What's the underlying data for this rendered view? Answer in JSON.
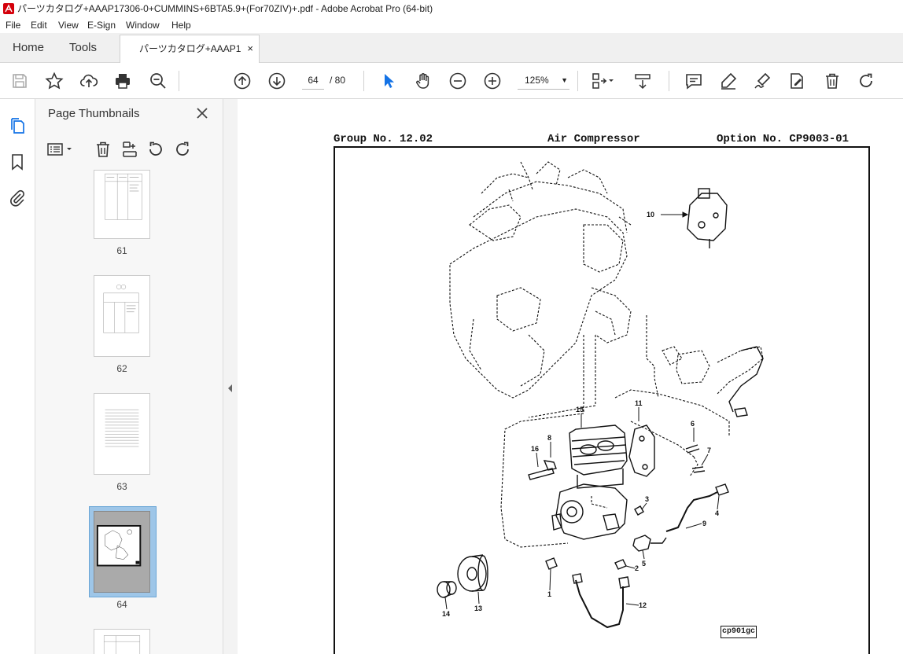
{
  "window": {
    "title": "パーツカタログ+AAAP17306-0+CUMMINS+6BTA5.9+(For70ZIV)+.pdf - Adobe Acrobat Pro (64-bit)"
  },
  "menu": [
    "File",
    "Edit",
    "View",
    "E-Sign",
    "Window",
    "Help"
  ],
  "tabs": {
    "home": "Home",
    "tools": "Tools",
    "document": "パーツカタログ+AAAP1...",
    "close": "×"
  },
  "toolbar": {
    "page_current": "64",
    "page_total": "/ 80",
    "zoom": "125%",
    "zoom_caret": "▼"
  },
  "panel": {
    "title": "Page Thumbnails",
    "thumbnails": [
      {
        "label": "61"
      },
      {
        "label": "62"
      },
      {
        "label": "63"
      },
      {
        "label": "64",
        "selected": true
      }
    ]
  },
  "document": {
    "group": "Group No. 12.02",
    "name": "Air Compressor",
    "option": "Option No. CP9003-01",
    "callouts": [
      "10",
      "15",
      "11",
      "6",
      "7",
      "8",
      "16",
      "3",
      "4",
      "9",
      "2",
      "5",
      "1",
      "12",
      "13",
      "14"
    ],
    "figure_code": "cp901gc"
  },
  "colors": {
    "accent": "#1473e6",
    "selection": "#9ec6e8"
  }
}
